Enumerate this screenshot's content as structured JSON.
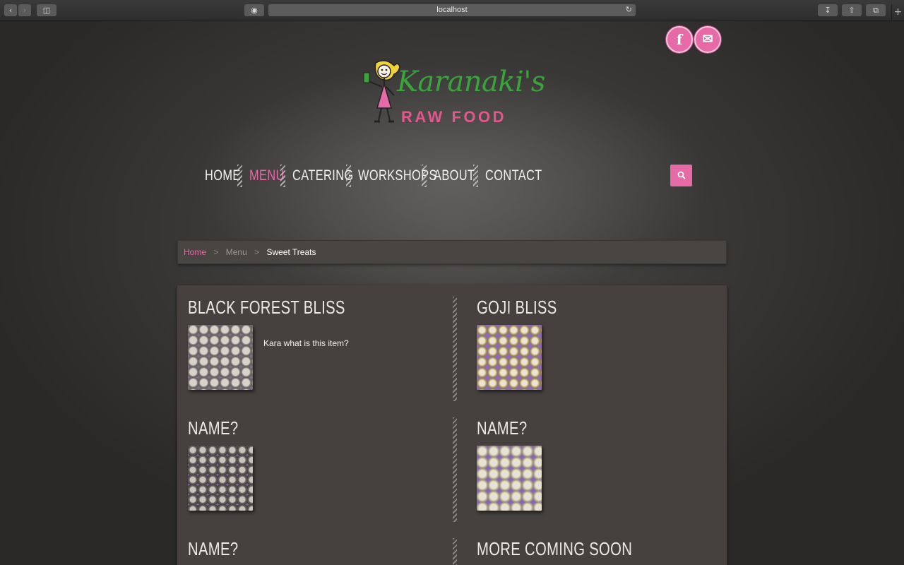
{
  "browser": {
    "url": "localhost"
  },
  "header": {
    "social": [
      {
        "name": "facebook",
        "glyph": "f"
      },
      {
        "name": "email",
        "glyph": "✉"
      }
    ],
    "logo": {
      "line1": "Karanaki's",
      "line2": "RAW FOOD"
    }
  },
  "nav": {
    "items": [
      {
        "label": "HOME",
        "active": false
      },
      {
        "label": "MENU",
        "active": true
      },
      {
        "label": "CATERING",
        "active": false
      },
      {
        "label": "WORKSHOPS",
        "active": false
      },
      {
        "label": "ABOUT",
        "active": false
      },
      {
        "label": "CONTACT",
        "active": false
      }
    ],
    "search_icon": "search-icon"
  },
  "breadcrumb": {
    "home": "Home",
    "separator": ">",
    "parent": "Menu",
    "current": "Sweet Treats"
  },
  "menu_items": [
    {
      "title": "BLACK FOREST BLISS",
      "description": "Kara what is this item?"
    },
    {
      "title": "GOJI BLISS",
      "description": ""
    },
    {
      "title": "NAME?",
      "description": ""
    },
    {
      "title": "NAME?",
      "description": ""
    },
    {
      "title": "NAME?",
      "description": ""
    },
    {
      "title": "MORE COMING SOON",
      "description": ""
    }
  ],
  "colors": {
    "accent_pink": "#e56aa5",
    "logo_green": "#3aa43a",
    "panel": "#46413e",
    "background": "#2b2a29"
  }
}
